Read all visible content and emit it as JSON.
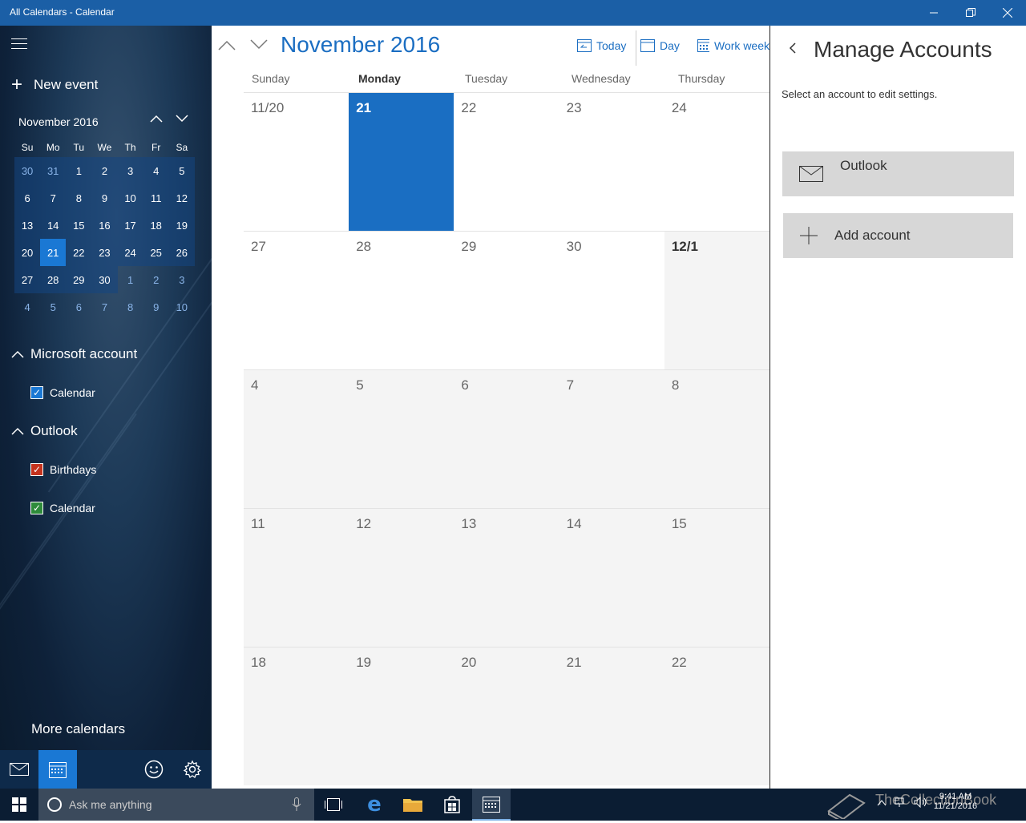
{
  "window": {
    "title": "All Calendars - Calendar"
  },
  "sidebar": {
    "new_event": "New event",
    "mini_month": "November 2016",
    "weekday_abbr": [
      "Su",
      "Mo",
      "Tu",
      "We",
      "Th",
      "Fr",
      "Sa"
    ],
    "weeks": [
      [
        "30",
        "31",
        "1",
        "2",
        "3",
        "4",
        "5"
      ],
      [
        "6",
        "7",
        "8",
        "9",
        "10",
        "11",
        "12"
      ],
      [
        "13",
        "14",
        "15",
        "16",
        "17",
        "18",
        "19"
      ],
      [
        "20",
        "21",
        "22",
        "23",
        "24",
        "25",
        "26"
      ],
      [
        "27",
        "28",
        "29",
        "30",
        "1",
        "2",
        "3"
      ],
      [
        "4",
        "5",
        "6",
        "7",
        "8",
        "9",
        "10"
      ]
    ],
    "groups": [
      {
        "name": "Microsoft account",
        "items": [
          {
            "label": "Calendar",
            "color": "#1a78d4"
          }
        ]
      },
      {
        "name": "Outlook",
        "items": [
          {
            "label": "Birthdays",
            "color": "#c4321d"
          },
          {
            "label": "Calendar",
            "color": "#2e8b3a"
          }
        ]
      }
    ],
    "more_calendars": "More calendars"
  },
  "main": {
    "month_title": "November 2016",
    "views": {
      "today": "Today",
      "day": "Day",
      "work_week": "Work week"
    },
    "day_headers": [
      "Sunday",
      "Monday",
      "Tuesday",
      "Wednesday",
      "Thursday"
    ],
    "weeks": [
      [
        "11/20",
        "21",
        "22",
        "23",
        "24"
      ],
      [
        "27",
        "28",
        "29",
        "30",
        "12/1"
      ],
      [
        "4",
        "5",
        "6",
        "7",
        "8"
      ],
      [
        "11",
        "12",
        "13",
        "14",
        "15"
      ],
      [
        "18",
        "19",
        "20",
        "21",
        "22"
      ]
    ]
  },
  "panel": {
    "title": "Manage Accounts",
    "subtitle": "Select an account to edit settings.",
    "account_label": "Outlook",
    "add_account": "Add account"
  },
  "taskbar": {
    "search_placeholder": "Ask me anything",
    "time": "9:41 AM",
    "date": "11/21/2016",
    "watermark": "TheCollectionBook"
  },
  "colors": {
    "accent": "#1a6ec2",
    "titlebar": "#1b5fa6"
  }
}
